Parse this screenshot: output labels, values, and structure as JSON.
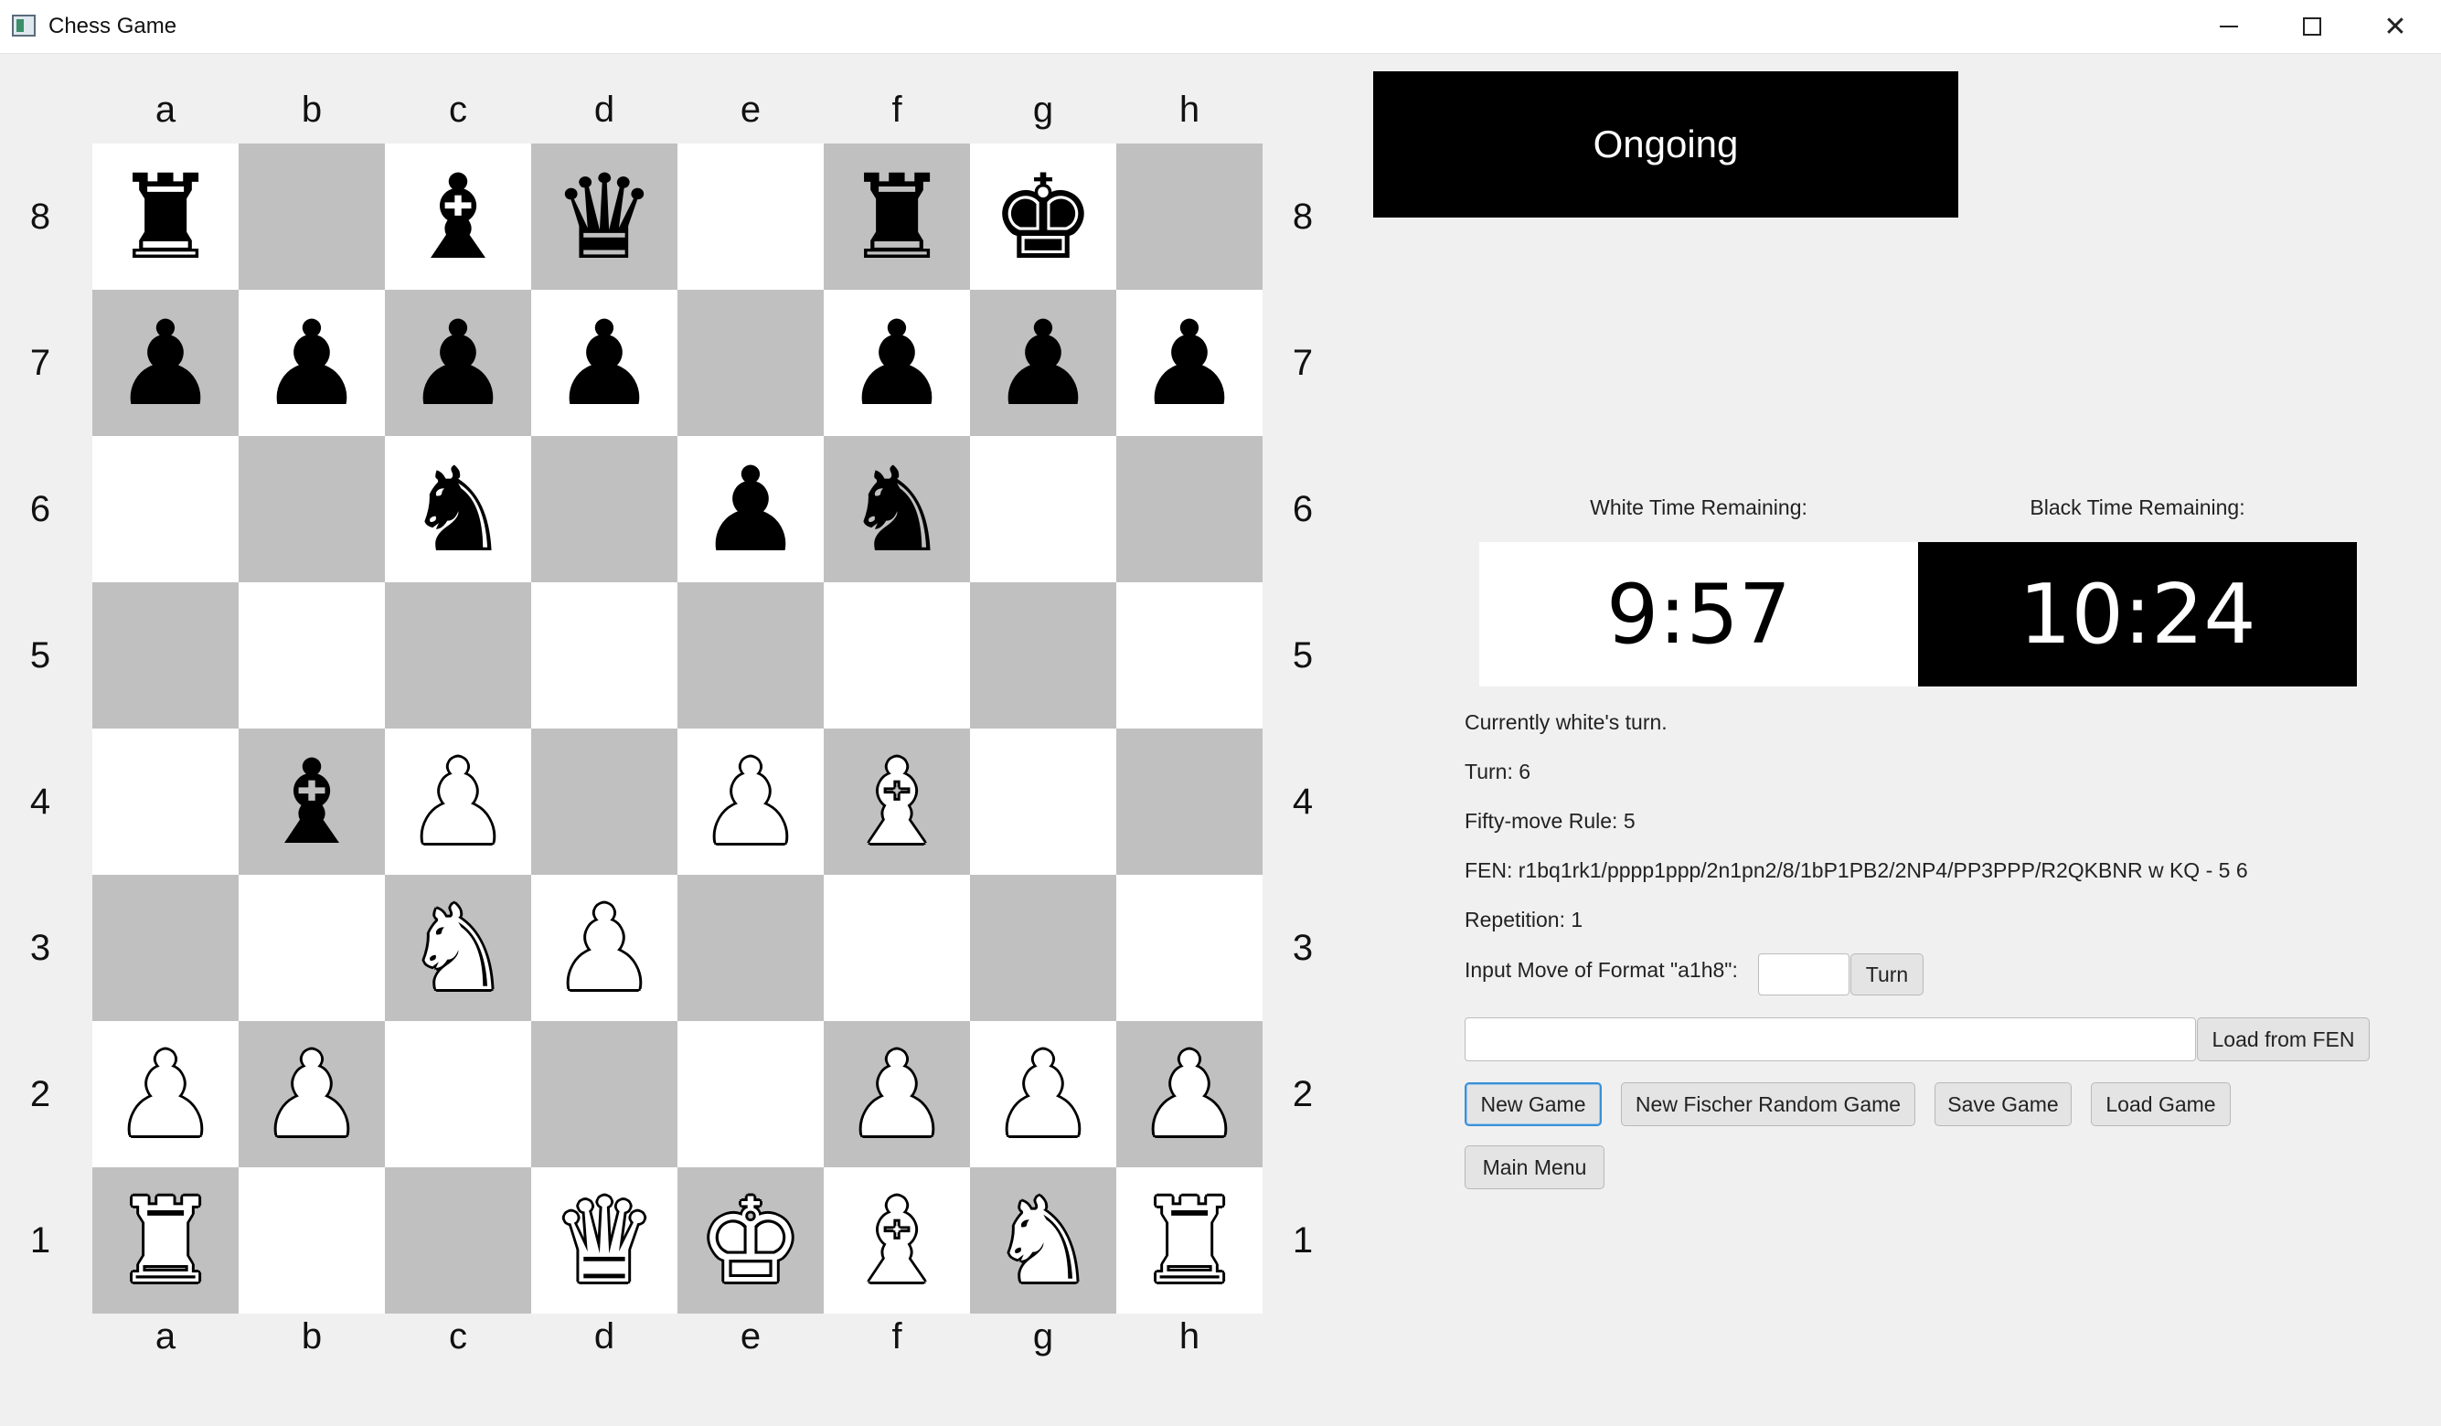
{
  "window": {
    "title": "Chess Game",
    "controls": {
      "minimize": "─",
      "maximize": "☐",
      "close": "✕"
    }
  },
  "board": {
    "files": [
      "a",
      "b",
      "c",
      "d",
      "e",
      "f",
      "g",
      "h"
    ],
    "ranks": [
      "8",
      "7",
      "6",
      "5",
      "4",
      "3",
      "2",
      "1"
    ],
    "colors": {
      "light": "#ffffff",
      "dark": "#c0c0c0"
    },
    "position": [
      [
        "r",
        "",
        "b",
        "q",
        "",
        "r",
        "k",
        ""
      ],
      [
        "p",
        "p",
        "p",
        "p",
        "",
        "p",
        "p",
        "p"
      ],
      [
        "",
        "",
        "n",
        "",
        "p",
        "n",
        "",
        ""
      ],
      [
        "",
        "",
        "",
        "",
        "",
        "",
        "",
        ""
      ],
      [
        "",
        "b",
        "P",
        "",
        "P",
        "B",
        "",
        ""
      ],
      [
        "",
        "",
        "N",
        "P",
        "",
        "",
        "",
        ""
      ],
      [
        "P",
        "P",
        "",
        "",
        "",
        "P",
        "P",
        "P"
      ],
      [
        "R",
        "",
        "",
        "Q",
        "K",
        "B",
        "N",
        "R"
      ]
    ]
  },
  "status": {
    "label": "Ongoing"
  },
  "clocks": {
    "white_label": "White Time Remaining:",
    "white_time": "9:57",
    "black_label": "Black Time Remaining:",
    "black_time": "10:24"
  },
  "info": {
    "turn_text": "Currently white's turn.",
    "turn_number": "Turn: 6",
    "fifty_move": "Fifty-move Rule: 5",
    "fen": "FEN: r1bq1rk1/pppp1ppp/2n1pn2/8/1bP1PB2/2NP4/PP3PPP/R2QKBNR w KQ - 5 6",
    "repetition": "Repetition: 1",
    "move_prompt": "Input Move of Format \"a1h8\":"
  },
  "move_input": {
    "value": "",
    "placeholder": ""
  },
  "fen_input": {
    "value": "",
    "placeholder": ""
  },
  "buttons": {
    "turn": "Turn",
    "load_fen": "Load from FEN",
    "new_game": "New Game",
    "new_fischer": "New Fischer Random Game",
    "save_game": "Save Game",
    "load_game": "Load Game",
    "main_menu": "Main Menu"
  }
}
